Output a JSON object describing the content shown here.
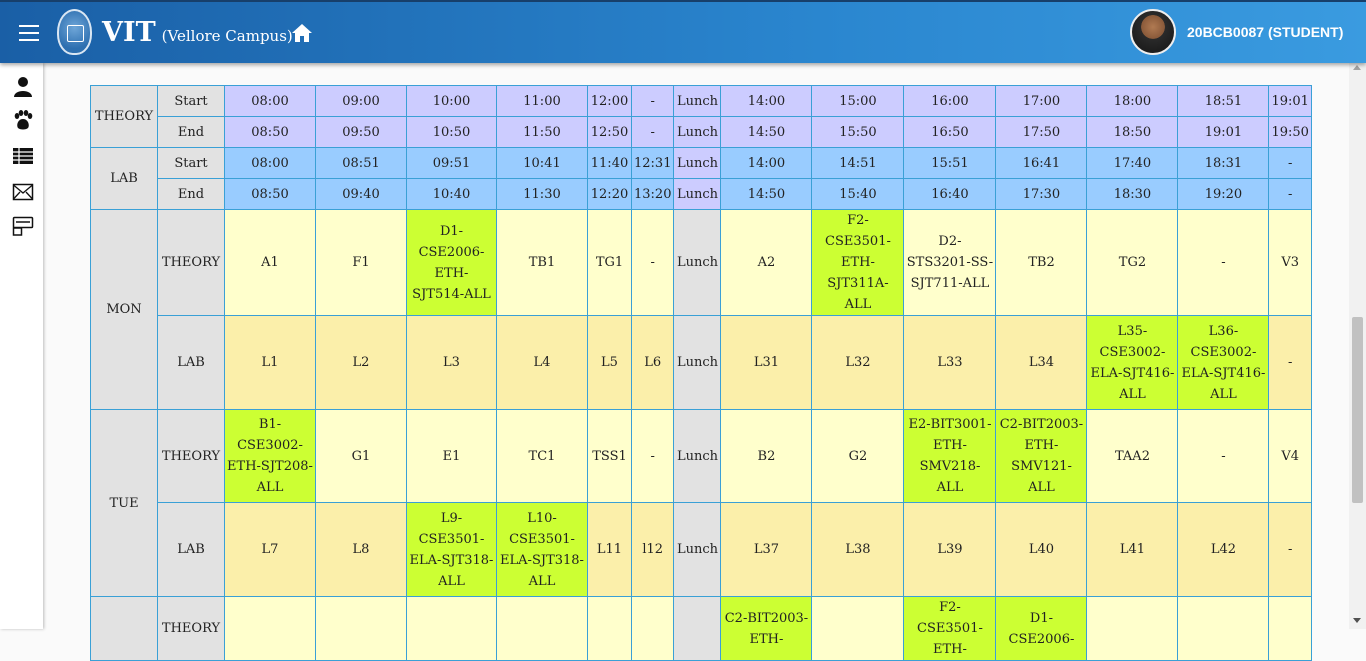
{
  "header": {
    "brand": "VIT",
    "campus": "(Vellore Campus)",
    "user": "20BCB0087 (STUDENT)"
  },
  "sidebar": {
    "icons": [
      "profile-icon",
      "paw-icon",
      "table-icon",
      "mail-icon",
      "card-icon"
    ]
  },
  "timetable": {
    "theory_label": "THEORY",
    "lab_label": "LAB",
    "start_label": "Start",
    "end_label": "End",
    "lunch": "Lunch",
    "theory_start": [
      "08:00",
      "09:00",
      "10:00",
      "11:00",
      "12:00",
      "-",
      "Lunch",
      "14:00",
      "15:00",
      "16:00",
      "17:00",
      "18:00",
      "18:51",
      "19:01"
    ],
    "theory_end": [
      "08:50",
      "09:50",
      "10:50",
      "11:50",
      "12:50",
      "-",
      "Lunch",
      "14:50",
      "15:50",
      "16:50",
      "17:50",
      "18:50",
      "19:01",
      "19:50"
    ],
    "lab_start": [
      "08:00",
      "08:51",
      "09:51",
      "10:41",
      "11:40",
      "12:31",
      "Lunch",
      "14:00",
      "14:51",
      "15:51",
      "16:41",
      "17:40",
      "18:31",
      "-"
    ],
    "lab_end": [
      "08:50",
      "09:40",
      "10:40",
      "11:30",
      "12:20",
      "13:20",
      "Lunch",
      "14:50",
      "15:40",
      "16:40",
      "17:30",
      "18:30",
      "19:20",
      "-"
    ],
    "days": [
      {
        "name": "MON",
        "theory": [
          "A1",
          "F1",
          "D1-CSE2006-ETH-SJT514-ALL",
          "TB1",
          "TG1",
          "-",
          "Lunch",
          "A2",
          "F2-CSE3501-ETH-SJT311A-ALL",
          "D2-STS3201-SS-SJT711-ALL",
          "TB2",
          "TG2",
          "-",
          "V3"
        ],
        "theory_sel": [
          false,
          false,
          true,
          false,
          false,
          false,
          false,
          false,
          true,
          false,
          false,
          false,
          false,
          false
        ],
        "lab": [
          "L1",
          "L2",
          "L3",
          "L4",
          "L5",
          "L6",
          "Lunch",
          "L31",
          "L32",
          "L33",
          "L34",
          "L35-CSE3002-ELA-SJT416-ALL",
          "L36-CSE3002-ELA-SJT416-ALL",
          "-"
        ],
        "lab_sel": [
          false,
          false,
          false,
          false,
          false,
          false,
          false,
          false,
          false,
          false,
          false,
          true,
          true,
          false
        ]
      },
      {
        "name": "TUE",
        "theory": [
          "B1-CSE3002-ETH-SJT208-ALL",
          "G1",
          "E1",
          "TC1",
          "TSS1",
          "-",
          "Lunch",
          "B2",
          "G2",
          "E2-BIT3001-ETH-SMV218-ALL",
          "C2-BIT2003-ETH-SMV121-ALL",
          "TAA2",
          "-",
          "V4"
        ],
        "theory_sel": [
          true,
          false,
          false,
          false,
          false,
          false,
          false,
          false,
          false,
          true,
          true,
          false,
          false,
          false
        ],
        "lab": [
          "L7",
          "L8",
          "L9-CSE3501-ELA-SJT318-ALL",
          "L10-CSE3501-ELA-SJT318-ALL",
          "L11",
          "l12",
          "Lunch",
          "L37",
          "L38",
          "L39",
          "L40",
          "L41",
          "L42",
          "-"
        ],
        "lab_sel": [
          false,
          false,
          true,
          true,
          false,
          false,
          false,
          false,
          false,
          false,
          false,
          false,
          false,
          false
        ]
      },
      {
        "name": "",
        "theory": [
          "",
          "",
          "",
          "",
          "",
          "",
          "",
          "C2-BIT2003-ETH-",
          "",
          "F2-CSE3501-ETH-",
          "D1-CSE2006-",
          "",
          "",
          ""
        ],
        "theory_sel": [
          false,
          false,
          false,
          false,
          false,
          false,
          false,
          true,
          false,
          true,
          true,
          false,
          false,
          false
        ]
      }
    ]
  }
}
